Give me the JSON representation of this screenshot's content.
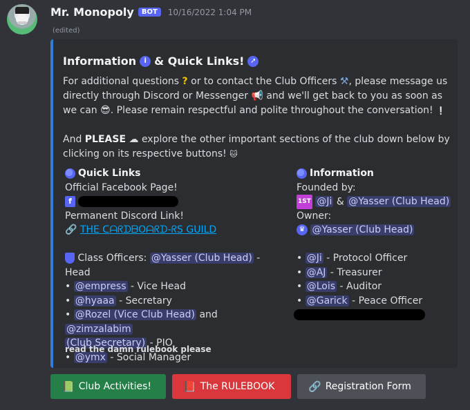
{
  "message": {
    "username": "Mr. Monopoly",
    "badge": "BOT",
    "timestamp": "10/16/2022 1:04 PM",
    "edited": "(edited)"
  },
  "embed": {
    "title_a": "Information",
    "title_b": "& Quick Links!",
    "para1_a": "For additional questions",
    "para1_b": "or to contact the Club Officers",
    "para1_c": ", please message us directly through Discord or Messenger",
    "para1_d": "and we'll get back to you as soon as we can",
    "para1_e": ". Please remain respectful and polite throughout the conversation!",
    "para2_a": "And",
    "para2_bold": "PLEASE",
    "para2_b": "explore the other important sections of the club down below by clicking on its respective buttons!",
    "quick_links": {
      "title": "Quick Links",
      "facebook_label": "Official Facebook Page!",
      "discord_label": "Permanent Discord Link!",
      "guild_link": "THE ᑕᗩᖇᗪᗷOᗩᖇᗪ-ᖇS GUILD",
      "officers_label": "Class Officers:",
      "officers": [
        {
          "mention": "@Yasser (Club Head)",
          "role": "- Head"
        },
        {
          "mention": "@empress",
          "role": "- Vice Head"
        },
        {
          "mention": "@hyaaa",
          "role": "- Secretary"
        },
        {
          "mention": "@Rozel (Vice Club Head)",
          "and": "and",
          "mention2": "@zimzalabim",
          "mention3": "(Club Secretary)",
          "role": "- PIO"
        },
        {
          "mention": "@ymx",
          "role": "- Social Manager"
        }
      ]
    },
    "information": {
      "title": "Information",
      "founded_label": "Founded by:",
      "founder1": "@Ji",
      "amp": "&",
      "founder2": "@Yasser (Club Head)",
      "owner_label": "Owner:",
      "owner": "@Yasser (Club Head)",
      "officers": [
        {
          "mention": "@Ji",
          "role": "- Protocol Officer"
        },
        {
          "mention": "@AJ",
          "role": "- Treasurer"
        },
        {
          "mention": "@Lois",
          "role": "- Auditor"
        },
        {
          "mention": "@Garick",
          "role": "- Peace Officer"
        }
      ]
    },
    "footer": "read the damn rulebook please",
    "accent_color": "#2f7fd4"
  },
  "buttons": [
    {
      "label": "Club Activities!",
      "icon": "book-icon",
      "color": "#248046"
    },
    {
      "label": "The RULEBOOK",
      "icon": "rulebook-icon",
      "color": "#da373c"
    },
    {
      "label": "Registration Form",
      "icon": "link-icon",
      "color": "#4e5058"
    }
  ]
}
